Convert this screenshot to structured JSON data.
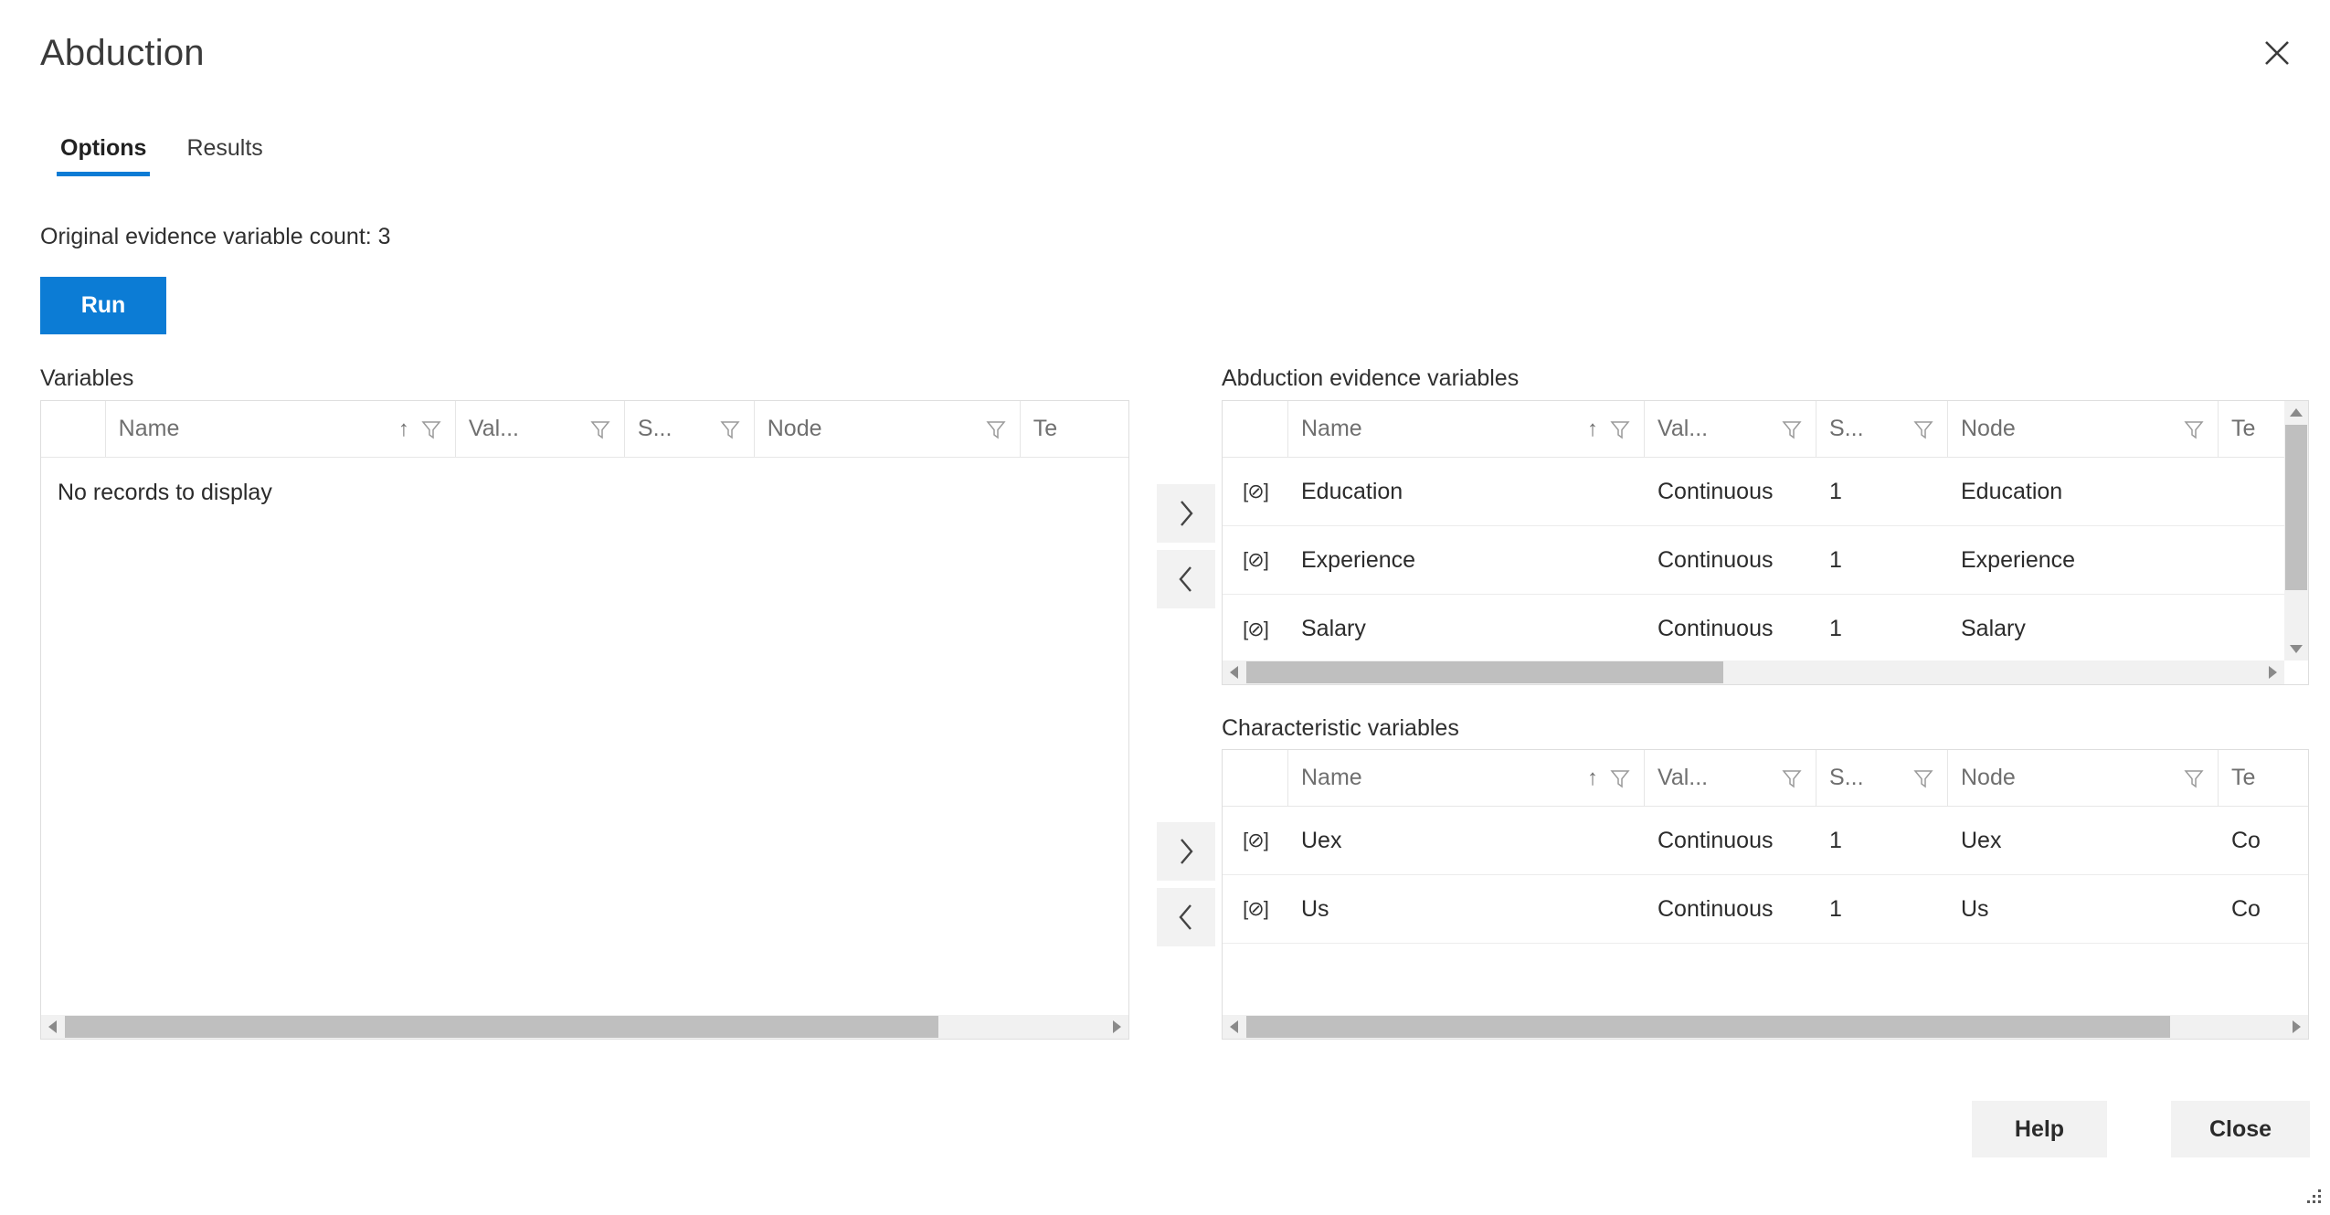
{
  "dialog": {
    "title": "Abduction",
    "close_icon": "close-icon"
  },
  "tabs": [
    {
      "label": "Options",
      "active": true
    },
    {
      "label": "Results",
      "active": false
    }
  ],
  "options": {
    "evidence_count_text": "Original evidence variable count: 3",
    "run_label": "Run"
  },
  "colors": {
    "accent": "#0c7cd5",
    "button_face": "#f2f2f2",
    "scroll_thumb": "#bfbfbf",
    "grid_border": "#dedede",
    "header_text": "#6f6f6f"
  },
  "icons": {
    "filter": "filter-icon",
    "sort_asc": "↑",
    "variable": "[⊘]",
    "move_right": "›",
    "move_left": "‹"
  },
  "variables_panel": {
    "label": "Variables",
    "columns": [
      {
        "key": "icon",
        "label": ""
      },
      {
        "key": "name",
        "label": "Name",
        "sorted": "asc"
      },
      {
        "key": "value_type",
        "label": "Val..."
      },
      {
        "key": "states",
        "label": "S..."
      },
      {
        "key": "node",
        "label": "Node"
      },
      {
        "key": "text",
        "label": "Te"
      }
    ],
    "rows": [],
    "empty_message": "No records to display",
    "hscroll": {
      "thumb_left_pct": 0,
      "thumb_width_pct": 84
    }
  },
  "evidence_panel": {
    "label": "Abduction evidence variables",
    "columns": [
      {
        "key": "icon",
        "label": ""
      },
      {
        "key": "name",
        "label": "Name",
        "sorted": "asc"
      },
      {
        "key": "value_type",
        "label": "Val..."
      },
      {
        "key": "states",
        "label": "S..."
      },
      {
        "key": "node",
        "label": "Node"
      },
      {
        "key": "text",
        "label": "Te"
      }
    ],
    "rows": [
      {
        "icon": "[⊘]",
        "name": "Education",
        "value_type": "Continuous",
        "states": "1",
        "node": "Education",
        "text": ""
      },
      {
        "icon": "[⊘]",
        "name": "Experience",
        "value_type": "Continuous",
        "states": "1",
        "node": "Experience",
        "text": ""
      },
      {
        "icon": "[⊘]",
        "name": "Salary",
        "value_type": "Continuous",
        "states": "1",
        "node": "Salary",
        "text": ""
      }
    ],
    "hscroll": {
      "thumb_left_pct": 0,
      "thumb_width_pct": 47
    },
    "vscroll": {
      "thumb_top_pct": 0,
      "thumb_height_pct": 78
    },
    "move_right_label": "›",
    "move_left_label": "‹"
  },
  "characteristic_panel": {
    "label": "Characteristic variables",
    "columns": [
      {
        "key": "icon",
        "label": ""
      },
      {
        "key": "name",
        "label": "Name",
        "sorted": "asc"
      },
      {
        "key": "value_type",
        "label": "Val..."
      },
      {
        "key": "states",
        "label": "S..."
      },
      {
        "key": "node",
        "label": "Node"
      },
      {
        "key": "text",
        "label": "Te"
      }
    ],
    "rows": [
      {
        "icon": "[⊘]",
        "name": "Uex",
        "value_type": "Continuous",
        "states": "1",
        "node": "Uex",
        "text": "Co"
      },
      {
        "icon": "[⊘]",
        "name": "Us",
        "value_type": "Continuous",
        "states": "1",
        "node": "Us",
        "text": "Co"
      }
    ],
    "hscroll": {
      "thumb_left_pct": 0,
      "thumb_width_pct": 89
    },
    "move_right_label": "›",
    "move_left_label": "‹"
  },
  "footer": {
    "help_label": "Help",
    "close_label": "Close",
    "resize_grip": "resize-grip-icon"
  }
}
